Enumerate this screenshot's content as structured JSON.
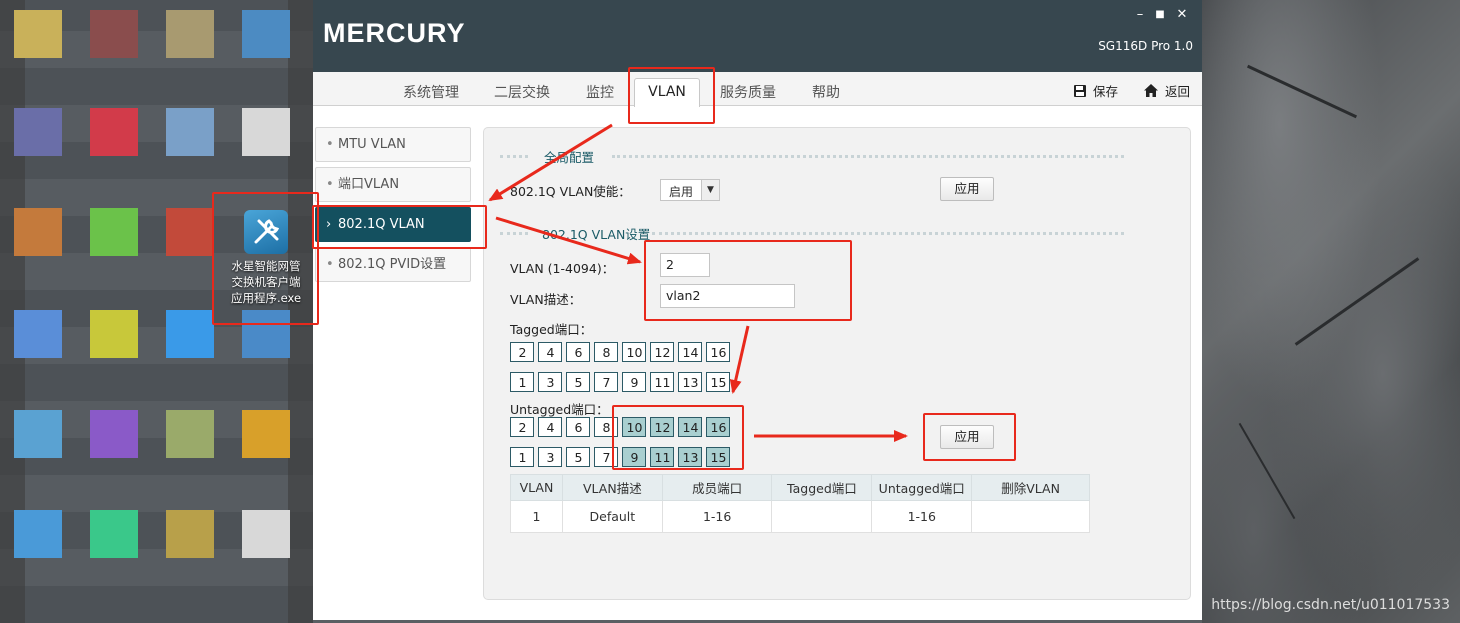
{
  "desktop": {
    "icon_label_line1": "水星智能网管",
    "icon_label_line2": "交换机客户端",
    "icon_label_line3": "应用程序.exe",
    "watermark": "https://blog.csdn.net/u011017533"
  },
  "app": {
    "brand": "MERCURY",
    "model": "SG116D Pro 1.0",
    "window_controls": [
      "–",
      "■",
      "✕"
    ],
    "menu": {
      "tabs": [
        "系统管理",
        "二层交换",
        "监控",
        "VLAN",
        "服务质量",
        "帮助"
      ],
      "active_tab": "VLAN",
      "save_label": "保存",
      "back_label": "返回"
    },
    "nav": {
      "items": [
        "MTU VLAN",
        "端口VLAN",
        "802.1Q VLAN",
        "802.1Q PVID设置"
      ],
      "active": "802.1Q VLAN"
    },
    "global": {
      "header": "全局配置",
      "enable_label": "802.1Q VLAN使能：",
      "enable_value": "启用",
      "apply_label": "应用"
    },
    "vlan_settings": {
      "header": "802.1Q VLAN设置",
      "vlan_id_label": "VLAN (1-4094)：",
      "vlan_id_value": "2",
      "desc_label": "VLAN描述：",
      "desc_value": "vlan2",
      "tagged_label": "Tagged端口：",
      "untagged_label": "Untagged端口：",
      "apply_label": "应用",
      "ports_top": [
        "2",
        "4",
        "6",
        "8",
        "10",
        "12",
        "14",
        "16"
      ],
      "ports_bottom": [
        "1",
        "3",
        "5",
        "7",
        "9",
        "11",
        "13",
        "15"
      ],
      "tagged_selected": [],
      "untagged_selected": [
        "9",
        "10",
        "11",
        "12",
        "13",
        "14",
        "15",
        "16"
      ]
    },
    "table": {
      "columns": [
        "VLAN",
        "VLAN描述",
        "成员端口",
        "Tagged端口",
        "Untagged端口",
        "删除VLAN"
      ],
      "rows": [
        [
          "1",
          "Default",
          "1-16",
          "",
          "1-16",
          ""
        ]
      ]
    }
  },
  "colors": {
    "titlebar": "#37474f",
    "nav_active": "#14505f",
    "port_selected": "#a9cfd0",
    "annotation": "#e8291c"
  }
}
